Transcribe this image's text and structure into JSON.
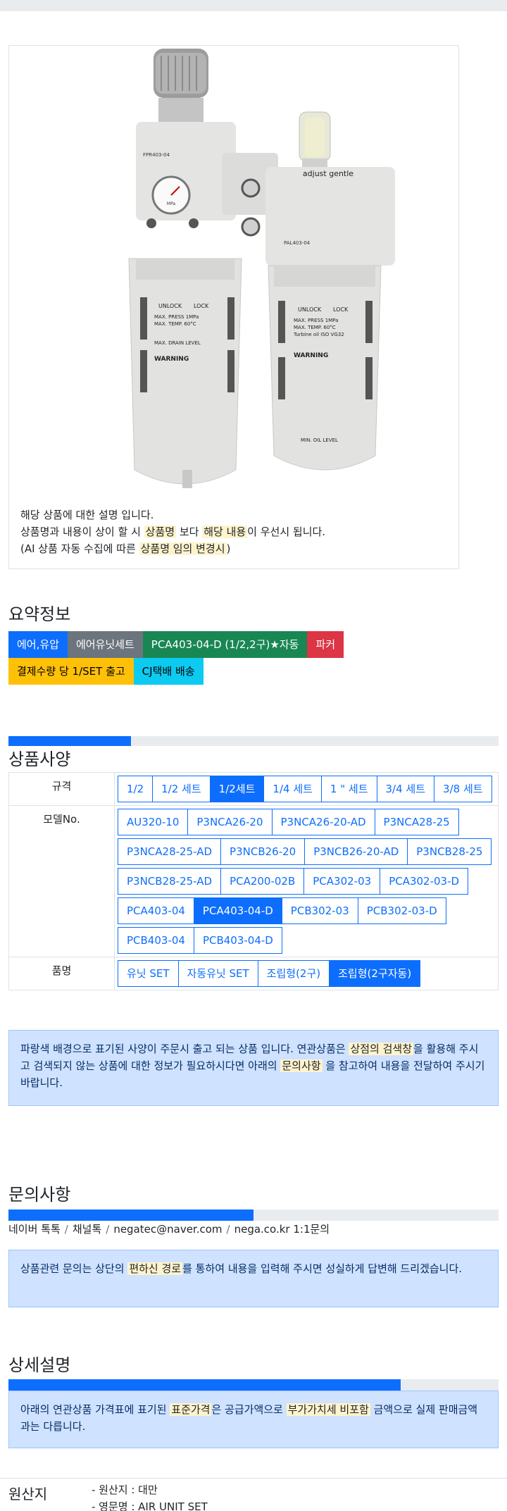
{
  "product": {
    "image_alt": "Parker air unit set PCA403-04-D (filter regulator + lubricator)",
    "image_text": {
      "adjust": "adjust gentle",
      "unlock": "UNLOCK",
      "lock": "LOCK",
      "left_model": "FPR403-04",
      "right_model": "PAL403-04",
      "max_press": "MAX. PRESS 1MPa",
      "max_temp": "MAX. TEMP. 60°C",
      "turbine": "Turbine oil ISO VG32",
      "max_drain": "MAX. DRAIN LEVEL",
      "warning": "WARNING",
      "min_oil": "MIN. OIL LEVEL",
      "gauge_unit": "MPa"
    },
    "desc": {
      "line1": "해당 상품에 대한 설명 입니다.",
      "line2_a": "상품명과 내용이 상이 할 시 ",
      "line2_m1": "상품명",
      "line2_b": " 보다 ",
      "line2_m2": "해당 내용",
      "line2_c": "이 우선시 됩니다.",
      "line3_a": "(AI 상품 자동 수집에 따른 ",
      "line3_m": "상품명 임의 변경시",
      "line3_b": ")"
    }
  },
  "summary": {
    "title": "요약정보",
    "row1": [
      {
        "label": "에어,유압",
        "color": "#0d6efd"
      },
      {
        "label": "에어유닛세트",
        "color": "#6c757d"
      },
      {
        "label": "PCA403-04-D (1/2,2구)★자동",
        "color": "#198754"
      },
      {
        "label": "파커",
        "color": "#dc3545"
      }
    ],
    "row2": [
      {
        "label": "결제수량 당 1/SET 출고",
        "color": "#ffc107"
      },
      {
        "label": "CJ택배 배송",
        "color": "#0dcaf0"
      }
    ],
    "progress": 0.25
  },
  "spec": {
    "title": "상품사양",
    "rows": [
      {
        "label": "규격",
        "options": [
          "1/2",
          "1/2 세트",
          "1/2세트",
          "1/4 세트",
          "1 \" 세트",
          "3/4 세트",
          "3/8 세트"
        ],
        "selected": "1/2세트"
      },
      {
        "label": "모델No.",
        "options": [
          "AU320-10",
          "P3NCA26-20",
          "P3NCA26-20-AD",
          "P3NCA28-25",
          "P3NCA28-25-AD",
          "P3NCB26-20",
          "P3NCB26-20-AD",
          "P3NCB28-25",
          "P3NCB28-25-AD",
          "PCA200-02B",
          "PCA302-03",
          "PCA302-03-D",
          "PCA403-04",
          "PCA403-04-D",
          "PCB302-03",
          "PCB302-03-D",
          "PCB403-04",
          "PCB403-04-D"
        ],
        "selected": "PCA403-04-D"
      },
      {
        "label": "품명",
        "options": [
          "유닛 SET",
          "자동유닛 SET",
          "조립형(2구)",
          "조립형(2구자동)"
        ],
        "selected": "조립형(2구자동)"
      }
    ],
    "notice": {
      "a": "파랑색 배경으로 표기된 사양이 주문시 출고 되는 상품 입니다. 연관상품은 ",
      "m1": "상점의 검색창",
      "b": "을 활용해 주시고 검색되지 않는 상품에 대한 정보가 필요하시다면 아래의 ",
      "m2": "문의사항",
      "c": " 을 참고하여 내용을 전달하여 주시기 바랍니다."
    }
  },
  "inquiry": {
    "title": "문의사항",
    "progress": 0.5,
    "links": [
      "네이버 톡톡",
      "채널톡",
      "negatec@naver.com",
      "nega.co.kr 1:1문의"
    ],
    "notice": {
      "a": "상품관련 문의는 상단의 ",
      "m": "편하신 경로",
      "b": "를 통하여 내용을 입력해 주시면 성실하게 답변해 드리겠습니다."
    }
  },
  "detail": {
    "title": "상세설명",
    "progress": 0.8,
    "notice": {
      "a": "아래의 연관상품 가격표에 표기된 ",
      "m1": "표준가격",
      "b": "은 공급가액으로 ",
      "m2": "부가가치세 비포함",
      "c": " 금액으로 실제 판매금액과는 다릅니다."
    }
  },
  "origin": {
    "label": "원산지",
    "lines": [
      "- 원산지 : 대만",
      "- 영문명 : AIR UNIT SET"
    ]
  }
}
